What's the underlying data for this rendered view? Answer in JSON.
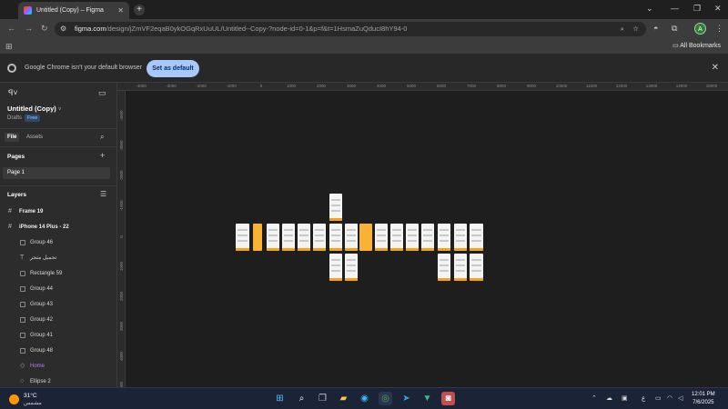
{
  "browser": {
    "tab_title": "Untitled (Copy) – Figma",
    "new_tab_label": "+",
    "url_host": "figma.com",
    "url_path": "/design/jZmVF2eqaB0ykOGqRxUuUL/Untitled--Copy-?node-id=0-1&p=f&t=1HsmaZuQducI8hY94-0",
    "bookmarks_label": "All Bookmarks",
    "profile_initial": "A",
    "infobar_message": "Google Chrome isn't your default browser",
    "infobar_button": "Set as default"
  },
  "figma": {
    "file_name": "Untitled (Copy)",
    "location": "Drafts",
    "plan_badge": "Free",
    "tabs": {
      "file": "File",
      "assets": "Assets"
    },
    "pages_heading": "Pages",
    "pages": [
      "Page 1"
    ],
    "layers_heading": "Layers",
    "layers": [
      {
        "name": "Frame 19",
        "level": 0,
        "icon": "frame-icon"
      },
      {
        "name": "iPhone 14 Plus - 22",
        "level": 0,
        "icon": "frame-icon"
      },
      {
        "name": "Group 46",
        "level": 1,
        "icon": "group-icon"
      },
      {
        "name": "تحميل متجر",
        "level": 1,
        "icon": "text-icon"
      },
      {
        "name": "Rectangle 59",
        "level": 1,
        "icon": "rectangle-icon"
      },
      {
        "name": "Group 44",
        "level": 1,
        "icon": "group-icon"
      },
      {
        "name": "Group 43",
        "level": 1,
        "icon": "group-icon"
      },
      {
        "name": "Group 42",
        "level": 1,
        "icon": "group-icon"
      },
      {
        "name": "Group 41",
        "level": 1,
        "icon": "group-icon"
      },
      {
        "name": "Group 48",
        "level": 1,
        "icon": "group-icon"
      },
      {
        "name": "Home",
        "level": 1,
        "icon": "component-icon",
        "color": "#b07cff"
      },
      {
        "name": "Ellipse 2",
        "level": 1,
        "icon": "ellipse-icon"
      }
    ],
    "ruler_h": [
      "-4000",
      "-3000",
      "-2000",
      "-1000",
      "0",
      "1000",
      "2000",
      "3000",
      "4000",
      "5000",
      "6000",
      "7000",
      "8000",
      "9000",
      "10000",
      "11000",
      "12000",
      "13000",
      "14000",
      "15000"
    ],
    "ruler_v": [
      "-4000",
      "-3000",
      "-2000",
      "-1000",
      "0",
      "1000",
      "2000",
      "3000",
      "4000",
      "5000",
      "6000"
    ]
  },
  "taskbar": {
    "temperature": "31°C",
    "condition": "مشمس",
    "time": "12:01 PM",
    "date": "7/6/2025",
    "language": "ع"
  },
  "colors": {
    "accent_orange": "#f5a31a",
    "figma_purple": "#b07cff",
    "chrome_blue": "#a8c7fa"
  }
}
